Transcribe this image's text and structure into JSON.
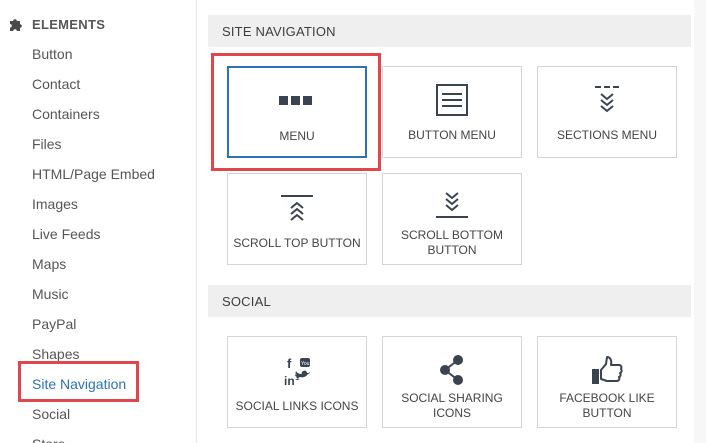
{
  "sidebar": {
    "header": {
      "title": "ELEMENTS",
      "icon": "puzzle-icon"
    },
    "items": [
      {
        "label": "Button"
      },
      {
        "label": "Contact"
      },
      {
        "label": "Containers"
      },
      {
        "label": "Files"
      },
      {
        "label": "HTML/Page Embed"
      },
      {
        "label": "Images"
      },
      {
        "label": "Live Feeds"
      },
      {
        "label": "Maps"
      },
      {
        "label": "Music"
      },
      {
        "label": "PayPal"
      },
      {
        "label": "Shapes"
      },
      {
        "label": "Site Navigation",
        "active": true
      },
      {
        "label": "Social"
      },
      {
        "label": "Store"
      }
    ]
  },
  "sections": [
    {
      "title": "SITE NAVIGATION",
      "tiles": [
        {
          "label": "MENU",
          "icon": "menu-dots-icon",
          "selected": true
        },
        {
          "label": "BUTTON MENU",
          "icon": "button-menu-icon"
        },
        {
          "label": "SECTIONS MENU",
          "icon": "sections-menu-icon"
        },
        {
          "label": "SCROLL TOP BUTTON",
          "icon": "scroll-top-icon"
        },
        {
          "label": "SCROLL BOTTOM BUTTON",
          "icon": "scroll-bottom-icon"
        }
      ]
    },
    {
      "title": "SOCIAL",
      "tiles": [
        {
          "label": "SOCIAL LINKS ICONS",
          "icon": "social-links-icon"
        },
        {
          "label": "SOCIAL SHARING ICONS",
          "icon": "share-icon"
        },
        {
          "label": "FACEBOOK LIKE BUTTON",
          "icon": "thumbs-up-icon"
        }
      ]
    }
  ],
  "colors": {
    "accent": "#2a73b9",
    "highlight": "#e0474c",
    "section_bg": "#efefef",
    "icon": "#3a4350"
  }
}
